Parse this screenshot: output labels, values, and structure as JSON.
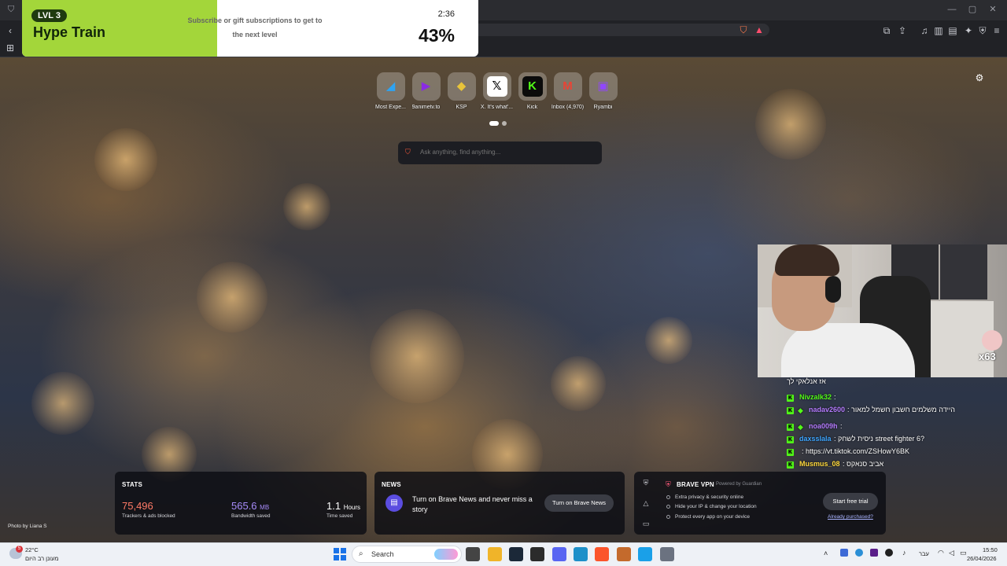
{
  "hype_train": {
    "level": "LVL 3",
    "title": "Hype Train",
    "message": "Subscribe or gift subscriptions to get to the next level",
    "time_left": "2:36",
    "progress": "43%",
    "accent_color": "#a3d63a"
  },
  "top_sites": [
    {
      "label": "Most Expe...",
      "icon": "azure-icon",
      "color": "#2ea3f2"
    },
    {
      "label": "9animetv.to",
      "icon": "play-icon",
      "color": "#8a2be2"
    },
    {
      "label": "KSP",
      "icon": "ksp-icon",
      "color": "#e8c43a"
    },
    {
      "label": "X. It's what'...",
      "icon": "x-icon",
      "color": "#000000"
    },
    {
      "label": "Kick",
      "icon": "kick-icon",
      "color": "#53fc18"
    },
    {
      "label": "Inbox (4,970)",
      "icon": "gmail-icon",
      "color": "#ea4335"
    },
    {
      "label": "Ryambi",
      "icon": "twitch-icon",
      "color": "#9146ff"
    }
  ],
  "search": {
    "placeholder": "Ask anything, find anything..."
  },
  "chat": {
    "header": "אז אנלאקי לך",
    "messages": [
      {
        "user": "Nivzalk32",
        "text": ":",
        "user_color": "#53fc18",
        "sub": false
      },
      {
        "user": "nadav2600",
        "text": ": היידה משלמים חשבון חשמל למאור",
        "user_color": "#b57cff",
        "sub": true
      },
      {
        "user": "noa009h",
        "text": ":",
        "user_color": "#b57cff",
        "sub": true
      },
      {
        "user": "daxsslala",
        "text": ": ניסית לשחק street fighter 6?",
        "user_color": "#3ea6ff",
        "sub": false
      },
      {
        "user": "",
        "text": ": https://vt.tiktok.com/ZSHowY6BK",
        "user_color": "#e84a5f",
        "sub": false
      },
      {
        "user": "Musmus_08",
        "text": ": אביב סנאקס",
        "user_color": "#ffd93d",
        "sub": false
      }
    ]
  },
  "stats": {
    "heading": "STATS",
    "items": [
      {
        "value": "75,496",
        "unit": "",
        "label": "Trackers & ads blocked",
        "color": "#ff7a66"
      },
      {
        "value": "565.6",
        "unit": "MB",
        "label": "Bandwidth saved",
        "color": "#a78bfa"
      },
      {
        "value": "1.1",
        "unit": "Hours",
        "label": "Time saved",
        "color": "#ffffff"
      }
    ]
  },
  "news": {
    "heading": "NEWS",
    "text": "Turn on Brave News and never miss a story",
    "button": "Turn on Brave News"
  },
  "vpn": {
    "heading": "BRAVE VPN",
    "powered": "Powered by Guardian",
    "features": [
      "Extra privacy & security online",
      "Hide your IP & change your location",
      "Protect every app on your device"
    ],
    "button": "Start free trial",
    "link": "Already purchased?"
  },
  "photo_credit": "Photo by Liana S",
  "taskbar": {
    "weather_temp": "22°C",
    "weather_desc": "מעונן רב היום",
    "weather_badge": "5",
    "search_label": "Search",
    "language": "עבר",
    "time": "15:50",
    "date": "26/04/2026"
  },
  "webcam": {
    "viewer_badge": "x63"
  }
}
